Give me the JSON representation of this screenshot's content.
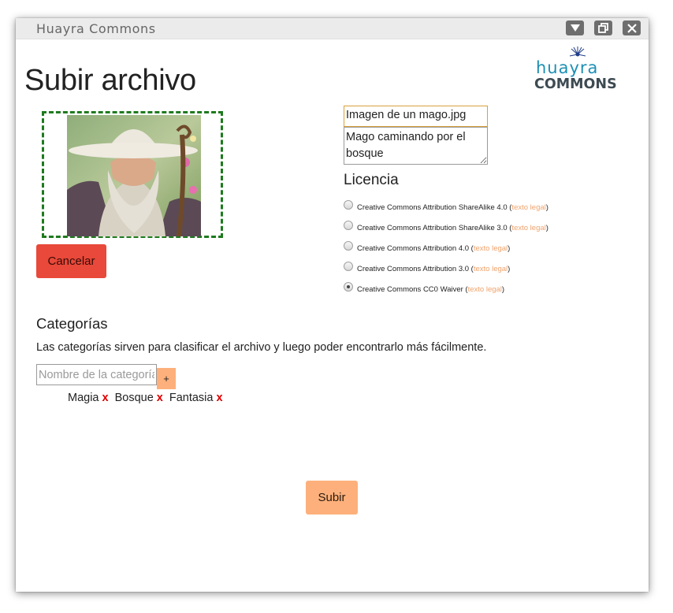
{
  "window": {
    "title": "Huayra Commons",
    "controls": [
      "minimize-icon",
      "restore-icon",
      "close-icon"
    ]
  },
  "logo": {
    "line1": "huayra",
    "line2": "COMMONS"
  },
  "page_title": "Subir archivo",
  "upload": {
    "file_name": "Imagen de un mago.jpg",
    "description": "Mago caminando por el bosque",
    "cancel_label": "Cancelar"
  },
  "license": {
    "title": "Licencia",
    "link_text": "texto legal",
    "options": [
      {
        "label": "Creative Commons Attribution ShareAlike 4.0",
        "checked": false
      },
      {
        "label": "Creative Commons Attribution ShareAlike 3.0",
        "checked": false
      },
      {
        "label": "Creative Commons Attribution 4.0",
        "checked": false
      },
      {
        "label": "Creative Commons Attribution 3.0",
        "checked": false
      },
      {
        "label": "Creative Commons CC0 Waiver",
        "checked": true
      }
    ]
  },
  "categories": {
    "title": "Categorías",
    "description": "Las categorías sirven para clasificar el archivo y luego poder encontrarlo más fácilmente.",
    "input_placeholder": "Nombre de la categoría",
    "add_label": "+",
    "remove_label": "x",
    "tags": [
      "Magia",
      "Bosque",
      "Fantasia"
    ]
  },
  "submit_label": "Subir",
  "colors": {
    "accent": "#fdb07b",
    "cancel": "#e8493a",
    "dashed_border": "#1e7a1e",
    "remove_x": "#e00000",
    "link": "#f0a36c"
  }
}
